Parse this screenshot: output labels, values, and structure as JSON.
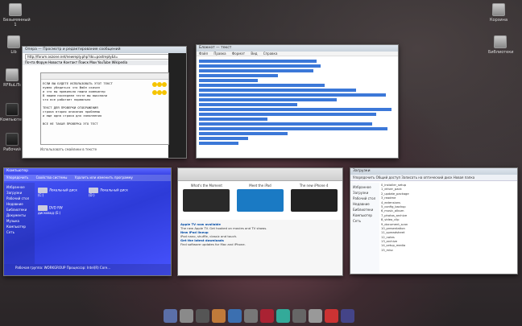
{
  "desktop": {
    "icons": [
      {
        "label": "Безымянный 1",
        "kind": "file"
      },
      {
        "label": "Lib",
        "kind": "file"
      },
      {
        "label": "RFRuLiTs",
        "kind": "file"
      },
      {
        "label": "Компьютер",
        "kind": "dark"
      },
      {
        "label": "Рабочий",
        "kind": "dark"
      },
      {
        "label": "Корзина",
        "kind": "file"
      },
      {
        "label": "Библиотеки",
        "kind": "file"
      }
    ]
  },
  "windows": {
    "browser1": {
      "title": "Опера — Просмотр и редактирование сообщений",
      "url": "http://forum.oszone.net/newreply.php?do=postreply&t=",
      "tabs": "Почта  Форум  Новости  Контакт  Поиск  Мои  YouTube  Wikipedia",
      "editor_lines": [
        "ЕСЛИ ВЫ БУДЕТЕ ИСПОЛЬЗОВАТЬ ЭТОТ ТЕКСТ",
        "нужно убедиться что файл скачан",
        "и что вы правильно нашли компьютер",
        "В нашем последнем тесте мы выяснили",
        "что все работает нормально",
        "",
        "ТЕКСТ ДЛЯ ПРОВЕРКИ ОТОБРАЖЕНИЯ",
        "строка вторая описания проблемы",
        "и еще одна строка для заполнения",
        "",
        "ВСЕ НЕ ТАКАЯ ПРОВЕРКА ЭТО ТЕСТ"
      ],
      "footer": "Использовать смайлики в тексте"
    },
    "textedit": {
      "title": "Блокнот — текст",
      "menu": [
        "Файл",
        "Правка",
        "Формат",
        "Вид",
        "Справка"
      ]
    },
    "explorer_blue": {
      "title": "Компьютер",
      "cmd": [
        "Упорядочить",
        "Свойства системы",
        "Удалить или изменить программу"
      ],
      "nav": [
        "Избранное",
        "Загрузки",
        "Рабочий стол",
        "Недавние",
        "Библиотеки",
        "Документы",
        "Музыка",
        "Компьютер",
        "Сеть"
      ],
      "drives": [
        {
          "label": "Локальный диск (C:)"
        },
        {
          "label": "Локальный диск (D:)"
        },
        {
          "label": "DVD RW дисковод (E:)"
        }
      ],
      "status": "Рабочая группа: WORKGROUP  Процессор: Intel(R) Core..."
    },
    "browser2": {
      "promos": [
        {
          "title": "What's the Moment",
          "color": "#2a2a2a"
        },
        {
          "title": "Meet the iPad",
          "color": "#1a7ac4"
        },
        {
          "title": "The new iPhone 4",
          "color": "#222"
        }
      ],
      "news": [
        {
          "head": "Apple TV now available",
          "text": "The new Apple TV. Get hooked on movies and TV shows."
        },
        {
          "head": "New iPod lineup",
          "text": "iPod nano, shuffle, classic and touch."
        },
        {
          "head": "Get the latest downloads",
          "text": "Find software updates for Mac and iPhone."
        }
      ]
    },
    "explorer_white": {
      "title": "Загрузки",
      "cmd": "Упорядочить  Общий доступ  Записать на оптический диск  Новая папка",
      "nav": [
        "Избранное",
        "Загрузки",
        "Рабочий стол",
        "Недавние",
        "Библиотеки",
        "Компьютер",
        "Сеть"
      ],
      "files": [
        "0_installer_setup",
        "1_driver_pack",
        "2_update_package",
        "3_readme",
        "4_extensions",
        "5_config_backup",
        "6_music_album",
        "7_photos_archive",
        "8_video_clip",
        "9_document_scan",
        "10_presentation",
        "11_spreadsheet",
        "12_notes",
        "13_archive",
        "14_setup_media",
        "15_misc"
      ]
    }
  },
  "dock": {
    "colors": [
      "#5b6fa8",
      "#8a8a8a",
      "#555",
      "#c07a3a",
      "#3b6fb0",
      "#777",
      "#a23",
      "#3a9",
      "#666",
      "#999",
      "#c33",
      "#448"
    ]
  }
}
